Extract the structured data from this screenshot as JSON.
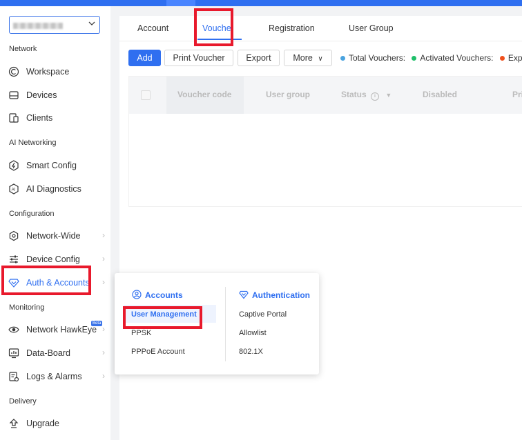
{
  "colors": {
    "accent": "#2f6ff0",
    "highlight": "#e8192c",
    "total": "#4aa3df",
    "activated": "#1fbf6a",
    "expired": "#f0501c"
  },
  "sidebar": {
    "sections": {
      "network": "Network",
      "ai_networking": "AI Networking",
      "configuration": "Configuration",
      "monitoring": "Monitoring",
      "delivery": "Delivery"
    },
    "items": [
      {
        "label": "Workspace",
        "icon": "workspace-icon"
      },
      {
        "label": "Devices",
        "icon": "devices-icon"
      },
      {
        "label": "Clients",
        "icon": "clients-icon"
      },
      {
        "label": "Smart Config",
        "icon": "smart-config-icon"
      },
      {
        "label": "AI Diagnostics",
        "icon": "ai-diagnostics-icon"
      },
      {
        "label": "Network-Wide",
        "icon": "network-wide-icon"
      },
      {
        "label": "Device Config",
        "icon": "device-config-icon"
      },
      {
        "label": "Auth & Accounts",
        "icon": "auth-accounts-icon"
      },
      {
        "label": "Network HawkEye",
        "icon": "hawkeye-icon",
        "badge": "Beta"
      },
      {
        "label": "Data-Board",
        "icon": "data-board-icon"
      },
      {
        "label": "Logs & Alarms",
        "icon": "logs-alarms-icon"
      },
      {
        "label": "Upgrade",
        "icon": "upgrade-icon"
      }
    ]
  },
  "tabs": [
    "Account",
    "Vouche",
    "Registration",
    "User Group"
  ],
  "toolbar": {
    "add": "Add",
    "print": "Print Voucher",
    "export": "Export",
    "more": "More"
  },
  "stats": {
    "total": "Total Vouchers:",
    "activated": "Activated Vouchers:",
    "expired": "Exp"
  },
  "table": {
    "headers": [
      "Voucher code",
      "User group",
      "Status",
      "Disabled",
      "Pri"
    ]
  },
  "popup": {
    "accounts": {
      "title": "Accounts",
      "items": [
        "User Management",
        "PPSK",
        "PPPoE Account"
      ]
    },
    "authentication": {
      "title": "Authentication",
      "items": [
        "Captive Portal",
        "Allowlist",
        "802.1X"
      ]
    }
  }
}
